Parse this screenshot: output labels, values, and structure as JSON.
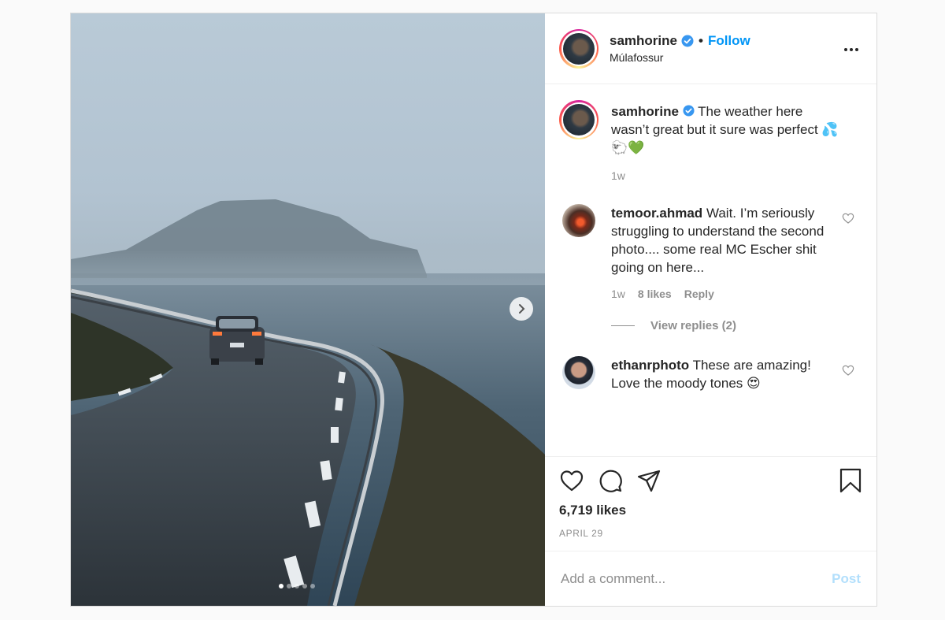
{
  "post": {
    "username": "samhorine",
    "follow_label": "Follow",
    "bullet": "•",
    "location": "Múlafossur",
    "caption_user": "samhorine",
    "caption_text": "The weather here wasn’t great but it sure was perfect 💦🐑💚",
    "caption_time": "1w",
    "carousel": {
      "total_slides": 5,
      "active_slide": 1
    }
  },
  "comments": [
    {
      "username": "temoor.ahmad",
      "text": "Wait. I’m seriously struggling to understand the second photo.... some real MC Escher shit going on here...",
      "time": "1w",
      "likes": "8 likes",
      "reply_label": "Reply",
      "view_replies": "View replies (2)"
    },
    {
      "username": "ethanrphoto",
      "text": "These are amazing! Love the moody tones 😍"
    }
  ],
  "actions": {
    "likes": "6,719 likes",
    "date": "APRIL 29"
  },
  "add_comment": {
    "placeholder": "Add a comment...",
    "post_label": "Post"
  },
  "colors": {
    "accent": "#0095f6",
    "post_disabled": "#b2dffc",
    "secondary_text": "#8e8e8e"
  }
}
